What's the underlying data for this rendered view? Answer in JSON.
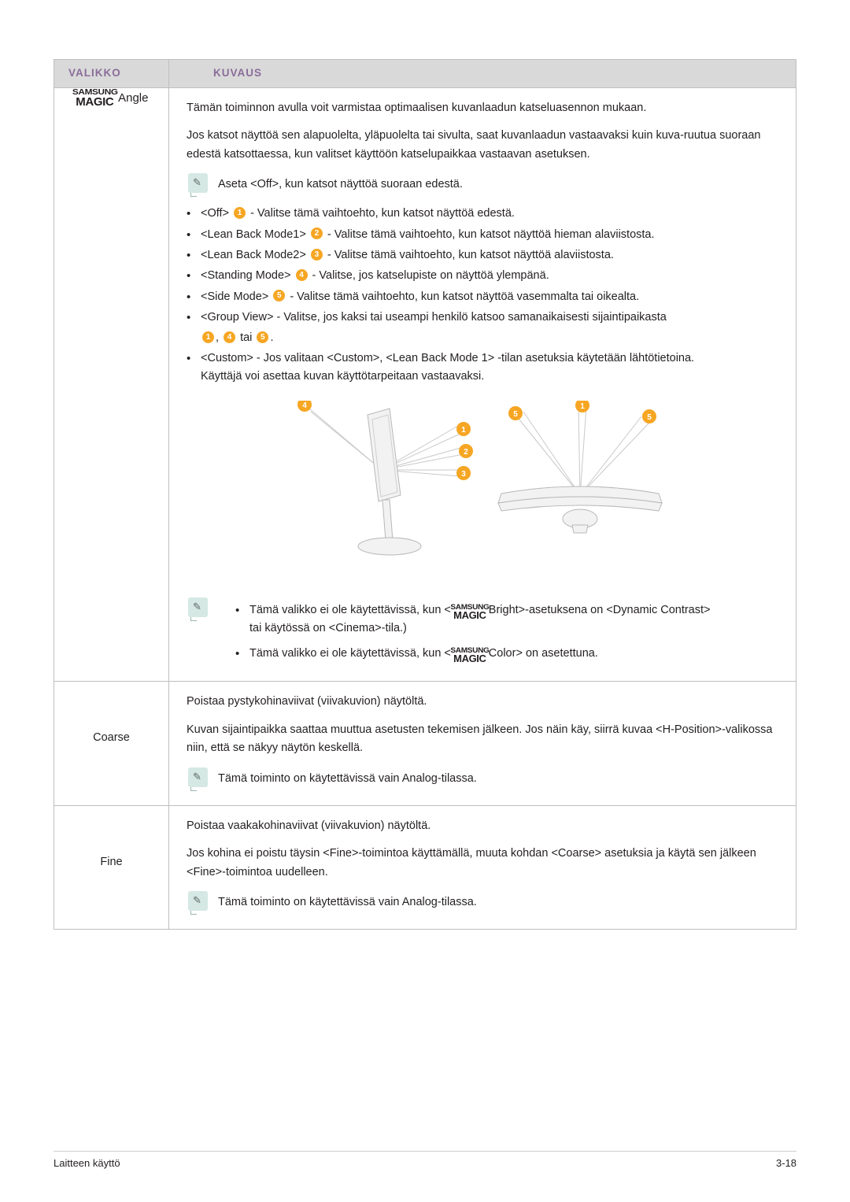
{
  "table": {
    "headers": {
      "menu": "VALIKKO",
      "description": "KUVAUS"
    },
    "rows": [
      {
        "menu_label": "Angle",
        "menu_logo": {
          "line1": "SAMSUNG",
          "line2": "MAGIC"
        },
        "intro1": "Tämän toiminnon avulla voit varmistaa optimaalisen kuvanlaadun katseluasennon mukaan.",
        "intro2": "Jos katsot näyttöä sen alapuolelta, yläpuolelta tai sivulta, saat kuvanlaadun vastaavaksi kuin kuva-ruutua suoraan edestä katsottaessa, kun valitset käyttöön katselupaikkaa vastaavan asetuksen.",
        "note1": "Aseta <Off>, kun katsot näyttöä suoraan edestä.",
        "bullets": [
          {
            "pre": "<Off>",
            "badge": "1",
            "post": "- Valitse tämä vaihtoehto, kun katsot näyttöä edestä."
          },
          {
            "pre": "<Lean Back Mode1>",
            "badge": "2",
            "post": "- Valitse tämä vaihtoehto, kun katsot näyttöä hieman alaviistosta."
          },
          {
            "pre": "<Lean Back Mode2>",
            "badge": "3",
            "post": "- Valitse tämä vaihtoehto, kun katsot näyttöä alaviistosta."
          },
          {
            "pre": "<Standing Mode>",
            "badge": "4",
            "post": "- Valitse, jos katselupiste on näyttöä ylempänä."
          },
          {
            "pre": "<Side Mode>",
            "badge": "5",
            "post": "- Valitse tämä vaihtoehto, kun katsot näyttöä vasemmalta tai oikealta."
          }
        ],
        "group_view": {
          "text": "<Group View> - Valitse, jos kaksi tai useampi henkilö katsoo samanaikaisesti sijaintipaikasta",
          "badges": [
            "1",
            "4",
            "5"
          ],
          "conj": "tai",
          "end": "."
        },
        "custom": {
          "line1": "<Custom> - Jos valitaan <Custom>, <Lean Back Mode 1> -tilan asetuksia käytetään lähtötietoina.",
          "line2": "Käyttäjä voi asettaa kuvan käyttötarpeitaan vastaavaksi."
        },
        "figure": {
          "left_labels": [
            "4",
            "1",
            "2",
            "3"
          ],
          "right_labels": [
            "5",
            "1",
            "5"
          ]
        },
        "footnotes": [
          {
            "pre": "Tämä valikko ei ole käytettävissä, kun <",
            "logo1": "SAMSUNG",
            "logo2": "MAGIC",
            "mid": "Bright>-asetuksena on <Dynamic Contrast>",
            "line2": "tai käytössä on <Cinema>-tila.)"
          },
          {
            "pre": "Tämä valikko ei ole käytettävissä, kun <",
            "logo1": "SAMSUNG",
            "logo2": "MAGIC",
            "mid": "Color> on asetettuna.",
            "line2": ""
          }
        ]
      },
      {
        "menu_label": "Coarse",
        "line1": "Poistaa pystykohinaviivat (viivakuvion) näytöltä.",
        "line2": "Kuvan sijaintipaikka saattaa muuttua asetusten tekemisen jälkeen. Jos näin käy, siirrä kuvaa <H-Position>-valikossa niin, että se näkyy näytön keskellä.",
        "note": "Tämä toiminto on käytettävissä vain Analog-tilassa."
      },
      {
        "menu_label": "Fine",
        "line1": "Poistaa vaakakohinaviivat (viivakuvion) näytöltä.",
        "line2": "Jos kohina ei poistu täysin <Fine>-toimintoa käyttämällä, muuta kohdan <Coarse> asetuksia ja käytä sen jälkeen <Fine>-toimintoa uudelleen.",
        "note": "Tämä toiminto on käytettävissä vain Analog-tilassa."
      }
    ]
  },
  "footer": {
    "left": "Laitteen käyttö",
    "right": "3-18"
  },
  "colors": {
    "header_text": "#8a6d9a",
    "header_bg": "#d9d9d9",
    "badge": "#f6a623",
    "note_bg": "#d5e8e4"
  }
}
